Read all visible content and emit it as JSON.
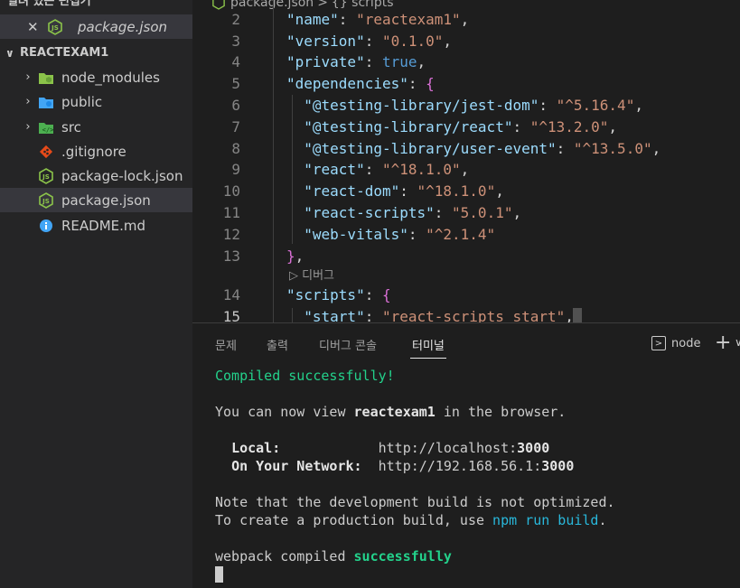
{
  "sidebar": {
    "open_editors_title": "열려 있는 편집기",
    "open_editor_file": "package.json",
    "project_name": "REACTEXAM1",
    "items": [
      {
        "label": "node_modules",
        "type": "folder",
        "icon": "folder-node-icon",
        "color": "#8bc34a"
      },
      {
        "label": "public",
        "type": "folder",
        "icon": "folder-public-icon",
        "color": "#42a5f5"
      },
      {
        "label": "src",
        "type": "folder",
        "icon": "folder-src-icon",
        "color": "#4caf50"
      },
      {
        "label": ".gitignore",
        "type": "file",
        "icon": "git-icon",
        "color": "#e64a19"
      },
      {
        "label": "package-lock.json",
        "type": "file",
        "icon": "nodejs-icon",
        "color": "#8bc34a"
      },
      {
        "label": "package.json",
        "type": "file",
        "icon": "nodejs-icon",
        "color": "#8bc34a"
      },
      {
        "label": "README.md",
        "type": "file",
        "icon": "info-icon",
        "color": "#42a5f5"
      }
    ]
  },
  "breadcrumb": {
    "file": "package.json",
    "separator": ">",
    "symbol": "{} scripts"
  },
  "editor": {
    "lines": [
      {
        "n": "2",
        "key": "\"name\"",
        "val": "\"reactexam1\"",
        "end": ","
      },
      {
        "n": "3",
        "key": "\"version\"",
        "val": "\"0.1.0\"",
        "end": ","
      },
      {
        "n": "4",
        "key": "\"private\"",
        "val": "true",
        "end": ","
      },
      {
        "n": "5",
        "key": "\"dependencies\"",
        "open": "{"
      },
      {
        "n": "6",
        "key": "\"@testing-library/jest-dom\"",
        "val": "\"^5.16.4\"",
        "end": ","
      },
      {
        "n": "7",
        "key": "\"@testing-library/react\"",
        "val": "\"^13.2.0\"",
        "end": ","
      },
      {
        "n": "8",
        "key": "\"@testing-library/user-event\"",
        "val": "\"^13.5.0\"",
        "end": ","
      },
      {
        "n": "9",
        "key": "\"react\"",
        "val": "\"^18.1.0\"",
        "end": ","
      },
      {
        "n": "10",
        "key": "\"react-dom\"",
        "val": "\"^18.1.0\"",
        "end": ","
      },
      {
        "n": "11",
        "key": "\"react-scripts\"",
        "val": "\"5.0.1\"",
        "end": ","
      },
      {
        "n": "12",
        "key": "\"web-vitals\"",
        "val": "\"^2.1.4\""
      },
      {
        "n": "13",
        "close": "}",
        "end": ","
      },
      {
        "n": "14",
        "key": "\"scripts\"",
        "open": "{"
      },
      {
        "n": "15",
        "key": "\"start\"",
        "val": "\"react-scripts start\"",
        "end": ","
      }
    ],
    "codelens": "▷ 디버그"
  },
  "panel": {
    "tabs": [
      "문제",
      "출력",
      "디버그 콘솔",
      "터미널"
    ],
    "active_tab": "터미널",
    "terminal_name": "node",
    "add_label": "+",
    "more_label": "∨"
  },
  "terminal": {
    "compiled": "Compiled successfully!",
    "view_prefix": "You can now view ",
    "app_name": "reactexam1",
    "view_suffix": " in the browser.",
    "local_label": "Local:",
    "local_url_prefix": "http://localhost:",
    "local_port": "3000",
    "network_label": "On Your Network:",
    "network_url_prefix": "http://192.168.56.1:",
    "network_port": "3000",
    "note1": "Note that the development build is not optimized.",
    "note2_prefix": "To create a production build, use ",
    "note2_cmd": "npm run build",
    "note2_suffix": ".",
    "webpack_prefix": "webpack compiled ",
    "webpack_status": "successfully"
  }
}
